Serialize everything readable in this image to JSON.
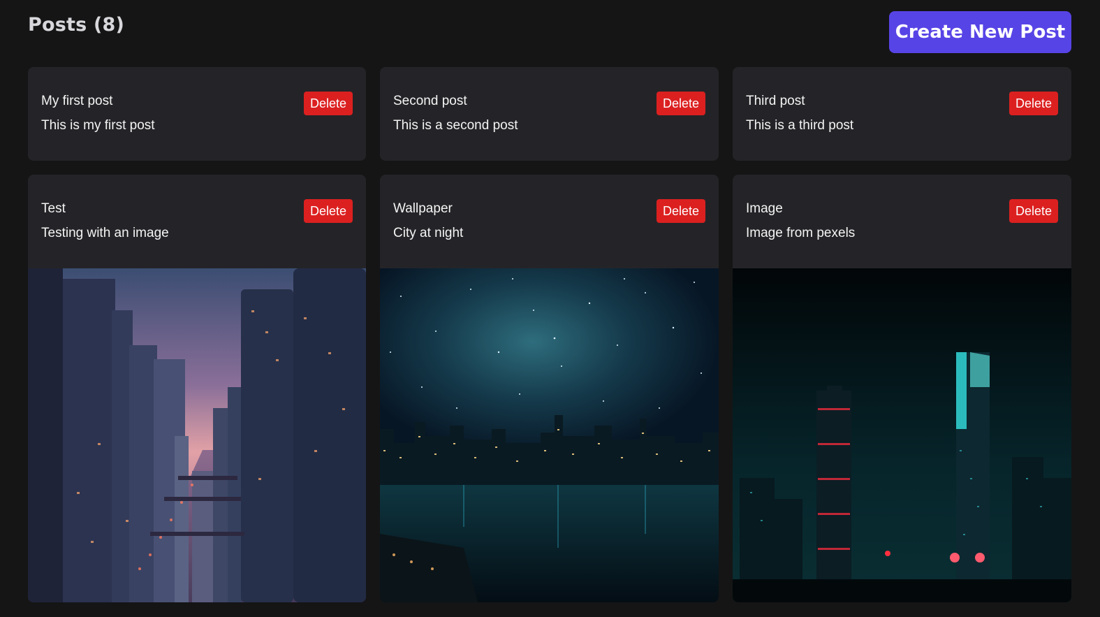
{
  "header": {
    "title": "Posts (8)",
    "create_label": "Create New Post"
  },
  "posts": [
    {
      "title": "My first post",
      "body": "This is my first post",
      "delete_label": "Delete",
      "has_image": false
    },
    {
      "title": "Second post",
      "body": "This is a second post",
      "delete_label": "Delete",
      "has_image": false
    },
    {
      "title": "Third post",
      "body": "This is a third post",
      "delete_label": "Delete",
      "has_image": false
    },
    {
      "title": "Test",
      "body": "Testing with an image",
      "delete_label": "Delete",
      "has_image": true,
      "image": "city-river-dusk"
    },
    {
      "title": "Wallpaper",
      "body": "City at night",
      "delete_label": "Delete",
      "has_image": true,
      "image": "starry-skyline"
    },
    {
      "title": "Image",
      "body": "Image from pexels",
      "delete_label": "Delete",
      "has_image": true,
      "image": "neon-towers"
    }
  ],
  "colors": {
    "background": "#151516",
    "card": "#242428",
    "accent": "#5744e6",
    "danger": "#dc2020"
  }
}
